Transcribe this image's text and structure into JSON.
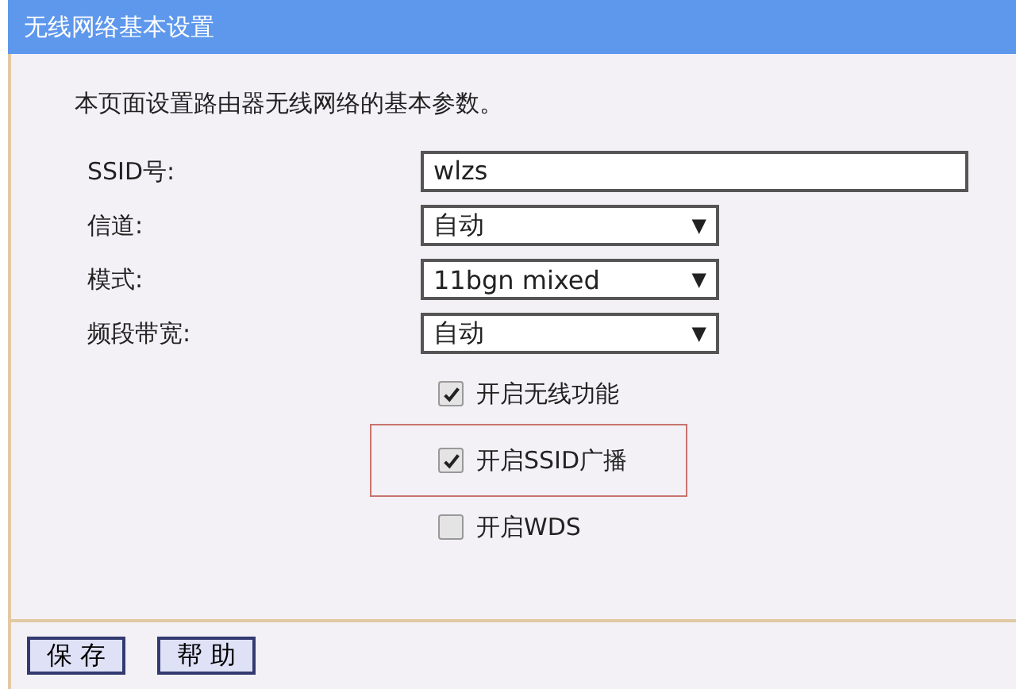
{
  "window": {
    "title": "无线网络基本设置"
  },
  "intro": "本页面设置路由器无线网络的基本参数。",
  "fields": [
    {
      "kind": "text",
      "label": "SSID号:",
      "value": "wlzs"
    },
    {
      "kind": "select",
      "label": "信道:",
      "value": "自动",
      "arrow": "▼"
    },
    {
      "kind": "select",
      "label": "模式:",
      "value": "11bgn mixed",
      "arrow": "▼"
    },
    {
      "kind": "select",
      "label": "频段带宽:",
      "value": "自动",
      "arrow": "▼"
    }
  ],
  "options": [
    {
      "label": "开启无线功能",
      "checked": true,
      "highlighted": false
    },
    {
      "label": "开启SSID广播",
      "checked": true,
      "highlighted": true
    },
    {
      "label": "开启WDS",
      "checked": false,
      "highlighted": false
    }
  ],
  "buttons": [
    "保 存",
    "帮 助"
  ]
}
